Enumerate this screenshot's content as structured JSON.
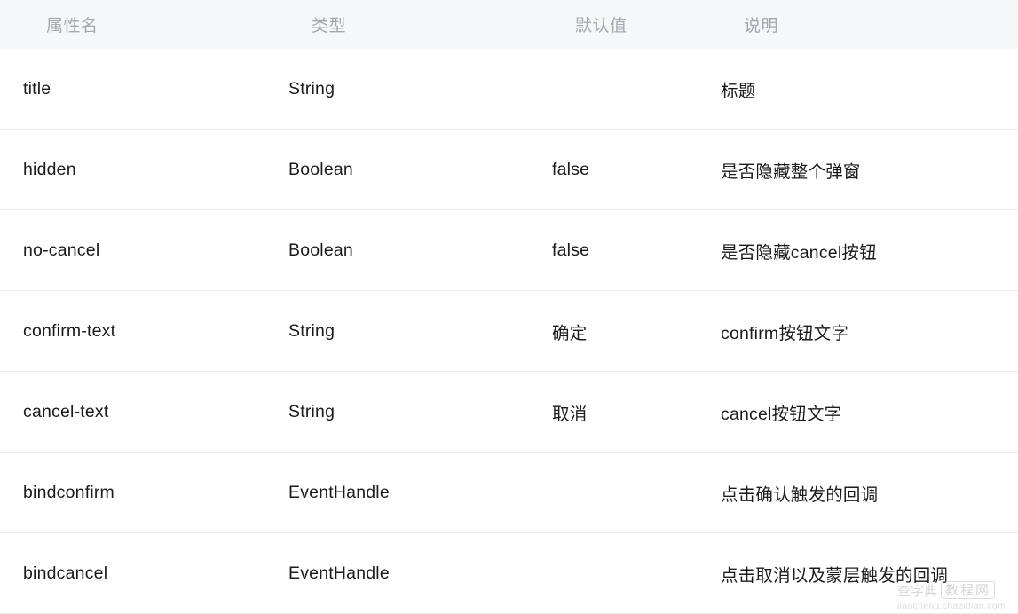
{
  "table": {
    "columns": [
      {
        "key": "name",
        "label": "属性名"
      },
      {
        "key": "type",
        "label": "类型"
      },
      {
        "key": "default",
        "label": "默认值"
      },
      {
        "key": "desc",
        "label": "说明"
      }
    ],
    "rows": [
      {
        "name": "title",
        "type": "String",
        "default": "",
        "desc": "标题"
      },
      {
        "name": "hidden",
        "type": "Boolean",
        "default": "false",
        "desc": "是否隐藏整个弹窗"
      },
      {
        "name": "no-cancel",
        "type": "Boolean",
        "default": "false",
        "desc": "是否隐藏cancel按钮"
      },
      {
        "name": "confirm-text",
        "type": "String",
        "default": "确定",
        "desc": "confirm按钮文字"
      },
      {
        "name": "cancel-text",
        "type": "String",
        "default": "取消",
        "desc": "cancel按钮文字"
      },
      {
        "name": "bindconfirm",
        "type": "EventHandle",
        "default": "",
        "desc": "点击确认触发的回调"
      },
      {
        "name": "bindcancel",
        "type": "EventHandle",
        "default": "",
        "desc": "点击取消以及蒙层触发的回调"
      }
    ]
  },
  "watermark": {
    "brand": "查字典",
    "tag": "教程网",
    "url": "jiaocheng.chazidian.com"
  },
  "colors": {
    "header_bg": "#f6f7f9",
    "header_text": "#a3a8b0",
    "body_text": "#1b1b1f",
    "divider": "#ededf0",
    "page_bg": "#ffffff"
  }
}
